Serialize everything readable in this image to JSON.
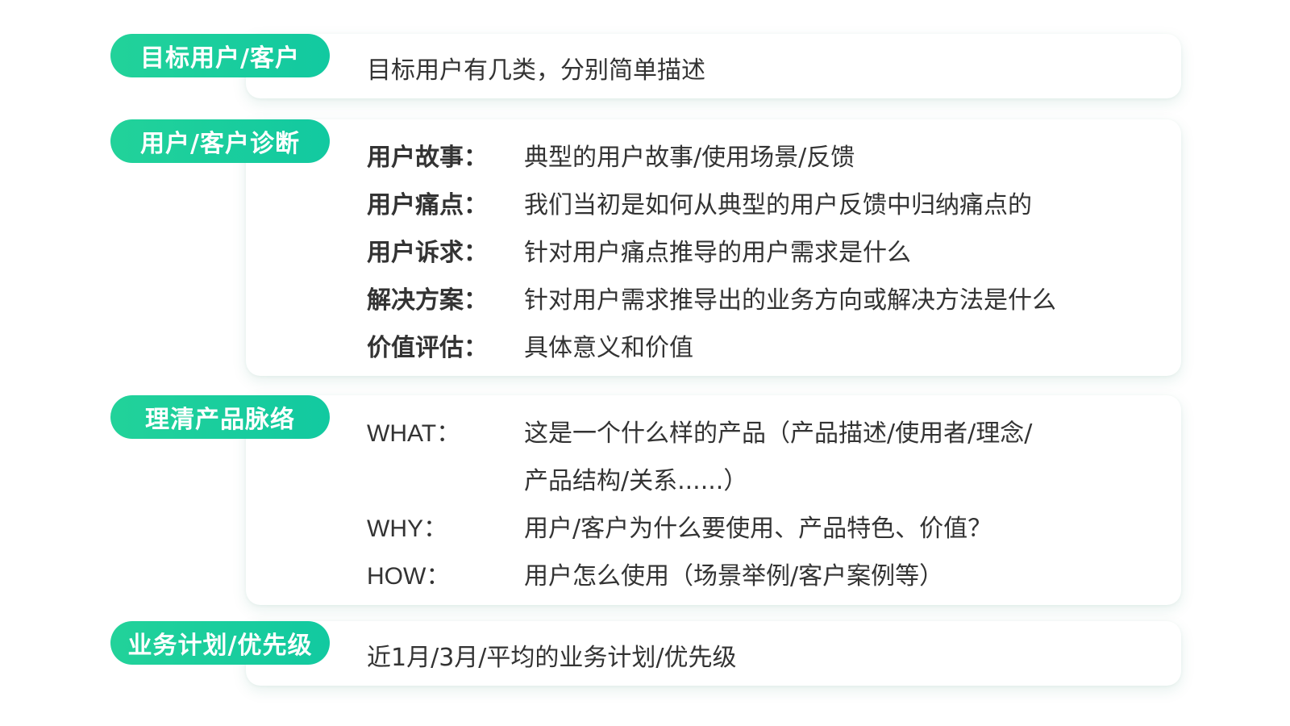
{
  "sections": [
    {
      "tag": "目标用户/客户",
      "description": "目标用户有几类，分别简单描述"
    },
    {
      "tag": "用户/客户诊断",
      "rows": [
        {
          "label": "用户故事：",
          "text": "典型的用户故事/使用场景/反馈"
        },
        {
          "label": "用户痛点：",
          "text": "我们当初是如何从典型的用户反馈中归纳痛点的"
        },
        {
          "label": "用户诉求：",
          "text": "针对用户痛点推导的用户需求是什么"
        },
        {
          "label": "解决方案：",
          "text": "针对用户需求推导出的业务方向或解决方法是什么"
        },
        {
          "label": "价值评估：",
          "text": "具体意义和价值"
        }
      ]
    },
    {
      "tag": "理清产品脉络",
      "rows": [
        {
          "label": "WHAT：",
          "text": "这是一个什么样的产品（产品描述/使用者/理念/",
          "text2": "产品结构/关系......）"
        },
        {
          "label": "WHY：",
          "text": "用户/客户为什么要使用、产品特色、价值？"
        },
        {
          "label": "HOW：",
          "text": "用户怎么使用（场景举例/客户案例等）"
        }
      ]
    },
    {
      "tag": "业务计划/优先级",
      "description": "近1月/3月/平均的业务计划/优先级"
    }
  ],
  "colors": {
    "accent": "#17cf9e",
    "text": "#333333",
    "card_bg": "#ffffff"
  }
}
